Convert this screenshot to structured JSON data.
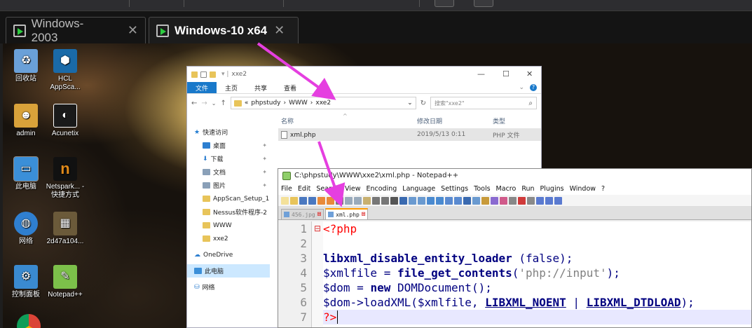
{
  "vm_tabs": [
    {
      "label": "Windows-2003"
    },
    {
      "label": "Windows-10 x64"
    }
  ],
  "desktop_icons": [
    {
      "label": "回收站",
      "icon": "recycle-bin-icon",
      "color": "#6aa0d8"
    },
    {
      "label": "HCL AppSca...",
      "icon": "appscan-icon",
      "color": "#1a6aa8"
    },
    {
      "label": "admin",
      "icon": "user-folder-icon",
      "color": "#d9a23a"
    },
    {
      "label": "Acunetix",
      "icon": "acunetix-icon",
      "color": "#1a1a1a"
    },
    {
      "label": "此电脑",
      "icon": "computer-icon",
      "color": "#3b8fd8"
    },
    {
      "label": "Netspark... - 快捷方式",
      "icon": "netsparker-icon",
      "color": "#e08a1a"
    },
    {
      "label": "网络",
      "icon": "network-icon",
      "color": "#2f7fd0"
    },
    {
      "label": "2d47a104...",
      "icon": "image-file-icon",
      "color": "#6b5a3a"
    },
    {
      "label": "控制面板",
      "icon": "control-panel-icon",
      "color": "#3a8ad0"
    },
    {
      "label": "Notepad++",
      "icon": "notepadpp-icon",
      "color": "#7cc04a"
    }
  ],
  "explorer": {
    "title": "xxe2",
    "ribbon_tabs": [
      "文件",
      "主页",
      "共享",
      "查看"
    ],
    "breadcrumb": [
      "«",
      "phpstudy",
      "WWW",
      "xxe2"
    ],
    "search_placeholder": "搜索\"xxe2\"",
    "columns": {
      "name": "名称",
      "date": "修改日期",
      "type": "类型"
    },
    "nav": [
      {
        "label": "快速访问",
        "kind": "header",
        "color": "#1e7ad0"
      },
      {
        "label": "桌面",
        "kind": "pinned",
        "color": "#2d7fd0"
      },
      {
        "label": "下载",
        "kind": "pinned",
        "color": "#2d7fd0"
      },
      {
        "label": "文档",
        "kind": "pinned",
        "color": "#8aa0b8"
      },
      {
        "label": "图片",
        "kind": "pinned",
        "color": "#8aa0b8"
      },
      {
        "label": "AppScan_Setup_1(",
        "kind": "folder",
        "color": "#e8c45a"
      },
      {
        "label": "Nessus软件程序-2",
        "kind": "folder",
        "color": "#e8c45a"
      },
      {
        "label": "WWW",
        "kind": "folder",
        "color": "#e8c45a"
      },
      {
        "label": "xxe2",
        "kind": "folder",
        "color": "#e8c45a"
      },
      {
        "label": "OneDrive",
        "kind": "header",
        "color": "#2d7fd0"
      },
      {
        "label": "此电脑",
        "kind": "selected",
        "color": "#3b8fd8"
      },
      {
        "label": "网络",
        "kind": "header",
        "color": "#2f7fd0"
      }
    ],
    "files": [
      {
        "name": "xml.php",
        "date": "2019/5/13 0:11",
        "type": "PHP 文件"
      }
    ]
  },
  "notepad": {
    "title": "C:\\phpstudy\\WWW\\xxe2\\xml.php - Notepad++",
    "menu": [
      "File",
      "Edit",
      "Search",
      "View",
      "Encoding",
      "Language",
      "Settings",
      "Tools",
      "Macro",
      "Run",
      "Plugins",
      "Window",
      "?"
    ],
    "tabs": [
      {
        "label": "456.jpg"
      },
      {
        "label": "xml.php"
      }
    ],
    "line_numbers": [
      "1",
      "2",
      "3",
      "4",
      "5",
      "6",
      "7"
    ],
    "code": {
      "l1": "<?php",
      "l3_fn": "libxml_disable_entity_loader",
      "l3_rest": " (false);",
      "l4_var": "$xmlfile",
      "l4_eq": " = ",
      "l4_fn": "file_get_contents",
      "l4_p1": "(",
      "l4_str": "'php://input'",
      "l4_p2": ");",
      "l5_var": "$dom",
      "l5_eq": " = ",
      "l5_kw": "new",
      "l5_rest": " DOMDocument();",
      "l6_var": "$dom",
      "l6_mid": "->loadXML(",
      "l6_var2": "$xmlfile",
      "l6_c": ", ",
      "l6_k1": "LIBXML_NOENT",
      "l6_pipe": " | ",
      "l6_k2": "LIBXML_DTDLOAD",
      "l6_end": ");",
      "l7": "?>"
    }
  },
  "colors": {
    "annotation_arrow": "#e53fe0",
    "accent": "#1979ca"
  }
}
